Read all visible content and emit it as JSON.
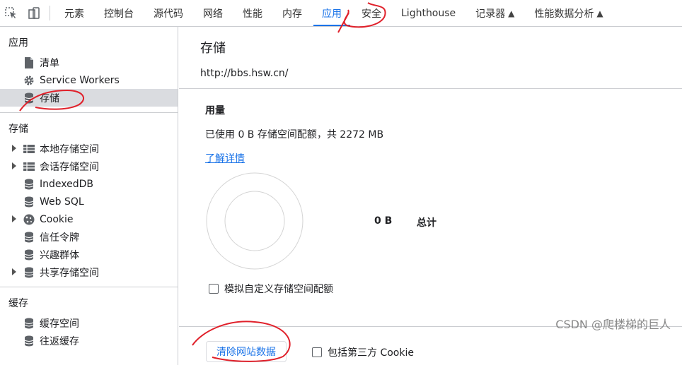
{
  "toolbar": {
    "tabs": [
      {
        "label": "元素"
      },
      {
        "label": "控制台"
      },
      {
        "label": "源代码"
      },
      {
        "label": "网络"
      },
      {
        "label": "性能"
      },
      {
        "label": "内存"
      },
      {
        "label": "应用"
      },
      {
        "label": "安全"
      },
      {
        "label": "Lighthouse"
      },
      {
        "label": "记录器"
      },
      {
        "label": "性能数据分析"
      }
    ],
    "active_tab": "应用",
    "icons": [
      "inspect-icon",
      "device-toggle-icon",
      "flask-icon"
    ]
  },
  "sidebar": {
    "app": {
      "title": "应用",
      "items": [
        {
          "label": "清单",
          "icon": "file-icon"
        },
        {
          "label": "Service Workers",
          "icon": "gear-icon"
        },
        {
          "label": "存储",
          "icon": "database-icon",
          "selected": true
        }
      ]
    },
    "storage": {
      "title": "存储",
      "items": [
        {
          "label": "本地存储空间",
          "icon": "table-icon",
          "expandable": true
        },
        {
          "label": "会话存储空间",
          "icon": "table-icon",
          "expandable": true
        },
        {
          "label": "IndexedDB",
          "icon": "database-icon"
        },
        {
          "label": "Web SQL",
          "icon": "database-icon"
        },
        {
          "label": "Cookie",
          "icon": "cookie-icon",
          "expandable": true
        },
        {
          "label": "信任令牌",
          "icon": "database-icon"
        },
        {
          "label": "兴趣群体",
          "icon": "database-icon"
        },
        {
          "label": "共享存储空间",
          "icon": "database-icon",
          "expandable": true
        }
      ]
    },
    "cache": {
      "title": "缓存",
      "items": [
        {
          "label": "缓存空间",
          "icon": "database-icon"
        },
        {
          "label": "往返缓存",
          "icon": "database-icon"
        }
      ]
    }
  },
  "main": {
    "title": "存储",
    "origin": "http://bbs.hsw.cn/",
    "usage_title": "用量",
    "usage_text": "已使用 0 B 存储空间配额，共 2272 MB",
    "learn_more": "了解详情",
    "legend_value": "0 B",
    "legend_label": "总计",
    "simulate_quota_label": "模拟自定义存储空间配额",
    "clear_button": "清除网站数据",
    "include_third_party_label": "包括第三方 Cookie"
  },
  "watermark": "CSDN @爬楼梯的巨人",
  "colors": {
    "accent": "#1a73e8",
    "selected_bg": "#dadce0",
    "annotation": "#e0202a"
  }
}
